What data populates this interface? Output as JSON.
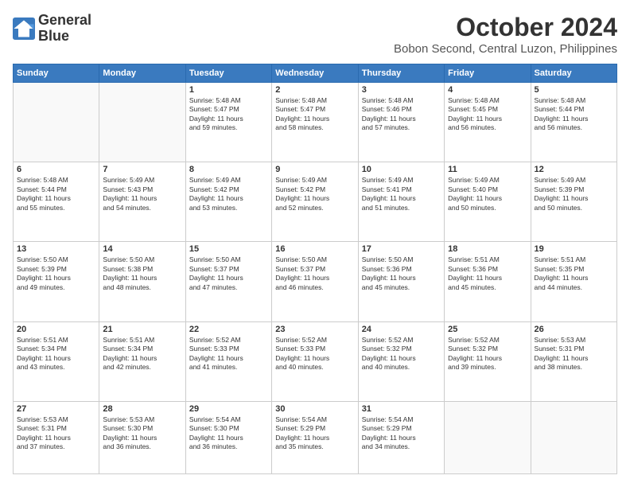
{
  "header": {
    "logo_line1": "General",
    "logo_line2": "Blue",
    "month": "October 2024",
    "location": "Bobon Second, Central Luzon, Philippines"
  },
  "weekdays": [
    "Sunday",
    "Monday",
    "Tuesday",
    "Wednesday",
    "Thursday",
    "Friday",
    "Saturday"
  ],
  "weeks": [
    [
      {
        "day": "",
        "info": ""
      },
      {
        "day": "",
        "info": ""
      },
      {
        "day": "1",
        "info": "Sunrise: 5:48 AM\nSunset: 5:47 PM\nDaylight: 11 hours\nand 59 minutes."
      },
      {
        "day": "2",
        "info": "Sunrise: 5:48 AM\nSunset: 5:47 PM\nDaylight: 11 hours\nand 58 minutes."
      },
      {
        "day": "3",
        "info": "Sunrise: 5:48 AM\nSunset: 5:46 PM\nDaylight: 11 hours\nand 57 minutes."
      },
      {
        "day": "4",
        "info": "Sunrise: 5:48 AM\nSunset: 5:45 PM\nDaylight: 11 hours\nand 56 minutes."
      },
      {
        "day": "5",
        "info": "Sunrise: 5:48 AM\nSunset: 5:44 PM\nDaylight: 11 hours\nand 56 minutes."
      }
    ],
    [
      {
        "day": "6",
        "info": "Sunrise: 5:48 AM\nSunset: 5:44 PM\nDaylight: 11 hours\nand 55 minutes."
      },
      {
        "day": "7",
        "info": "Sunrise: 5:49 AM\nSunset: 5:43 PM\nDaylight: 11 hours\nand 54 minutes."
      },
      {
        "day": "8",
        "info": "Sunrise: 5:49 AM\nSunset: 5:42 PM\nDaylight: 11 hours\nand 53 minutes."
      },
      {
        "day": "9",
        "info": "Sunrise: 5:49 AM\nSunset: 5:42 PM\nDaylight: 11 hours\nand 52 minutes."
      },
      {
        "day": "10",
        "info": "Sunrise: 5:49 AM\nSunset: 5:41 PM\nDaylight: 11 hours\nand 51 minutes."
      },
      {
        "day": "11",
        "info": "Sunrise: 5:49 AM\nSunset: 5:40 PM\nDaylight: 11 hours\nand 50 minutes."
      },
      {
        "day": "12",
        "info": "Sunrise: 5:49 AM\nSunset: 5:39 PM\nDaylight: 11 hours\nand 50 minutes."
      }
    ],
    [
      {
        "day": "13",
        "info": "Sunrise: 5:50 AM\nSunset: 5:39 PM\nDaylight: 11 hours\nand 49 minutes."
      },
      {
        "day": "14",
        "info": "Sunrise: 5:50 AM\nSunset: 5:38 PM\nDaylight: 11 hours\nand 48 minutes."
      },
      {
        "day": "15",
        "info": "Sunrise: 5:50 AM\nSunset: 5:37 PM\nDaylight: 11 hours\nand 47 minutes."
      },
      {
        "day": "16",
        "info": "Sunrise: 5:50 AM\nSunset: 5:37 PM\nDaylight: 11 hours\nand 46 minutes."
      },
      {
        "day": "17",
        "info": "Sunrise: 5:50 AM\nSunset: 5:36 PM\nDaylight: 11 hours\nand 45 minutes."
      },
      {
        "day": "18",
        "info": "Sunrise: 5:51 AM\nSunset: 5:36 PM\nDaylight: 11 hours\nand 45 minutes."
      },
      {
        "day": "19",
        "info": "Sunrise: 5:51 AM\nSunset: 5:35 PM\nDaylight: 11 hours\nand 44 minutes."
      }
    ],
    [
      {
        "day": "20",
        "info": "Sunrise: 5:51 AM\nSunset: 5:34 PM\nDaylight: 11 hours\nand 43 minutes."
      },
      {
        "day": "21",
        "info": "Sunrise: 5:51 AM\nSunset: 5:34 PM\nDaylight: 11 hours\nand 42 minutes."
      },
      {
        "day": "22",
        "info": "Sunrise: 5:52 AM\nSunset: 5:33 PM\nDaylight: 11 hours\nand 41 minutes."
      },
      {
        "day": "23",
        "info": "Sunrise: 5:52 AM\nSunset: 5:33 PM\nDaylight: 11 hours\nand 40 minutes."
      },
      {
        "day": "24",
        "info": "Sunrise: 5:52 AM\nSunset: 5:32 PM\nDaylight: 11 hours\nand 40 minutes."
      },
      {
        "day": "25",
        "info": "Sunrise: 5:52 AM\nSunset: 5:32 PM\nDaylight: 11 hours\nand 39 minutes."
      },
      {
        "day": "26",
        "info": "Sunrise: 5:53 AM\nSunset: 5:31 PM\nDaylight: 11 hours\nand 38 minutes."
      }
    ],
    [
      {
        "day": "27",
        "info": "Sunrise: 5:53 AM\nSunset: 5:31 PM\nDaylight: 11 hours\nand 37 minutes."
      },
      {
        "day": "28",
        "info": "Sunrise: 5:53 AM\nSunset: 5:30 PM\nDaylight: 11 hours\nand 36 minutes."
      },
      {
        "day": "29",
        "info": "Sunrise: 5:54 AM\nSunset: 5:30 PM\nDaylight: 11 hours\nand 36 minutes."
      },
      {
        "day": "30",
        "info": "Sunrise: 5:54 AM\nSunset: 5:29 PM\nDaylight: 11 hours\nand 35 minutes."
      },
      {
        "day": "31",
        "info": "Sunrise: 5:54 AM\nSunset: 5:29 PM\nDaylight: 11 hours\nand 34 minutes."
      },
      {
        "day": "",
        "info": ""
      },
      {
        "day": "",
        "info": ""
      }
    ]
  ]
}
